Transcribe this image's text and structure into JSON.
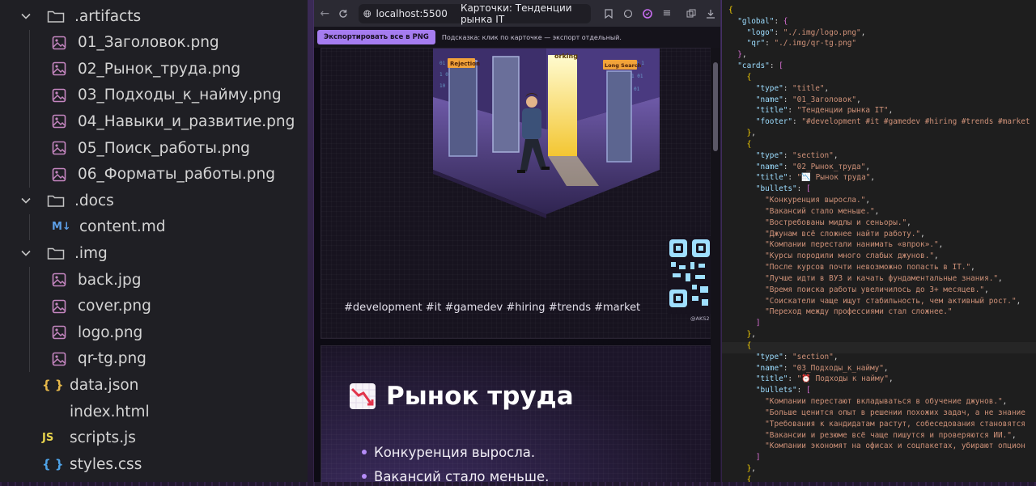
{
  "explorer": {
    "items": [
      {
        "label": ".artifacts",
        "kind": "folder",
        "depth": 0
      },
      {
        "label": "01_Заголовок.png",
        "kind": "image",
        "depth": 1
      },
      {
        "label": "02_Рынок_труда.png",
        "kind": "image",
        "depth": 1
      },
      {
        "label": "03_Подходы_к_найму.png",
        "kind": "image",
        "depth": 1
      },
      {
        "label": "04_Навыки_и_развитие.png",
        "kind": "image",
        "depth": 1
      },
      {
        "label": "05_Поиск_работы.png",
        "kind": "image",
        "depth": 1
      },
      {
        "label": "06_Форматы_работы.png",
        "kind": "image",
        "depth": 1
      },
      {
        "label": ".docs",
        "kind": "folder",
        "depth": 0
      },
      {
        "label": "content.md",
        "kind": "markdown",
        "depth": 1
      },
      {
        "label": ".img",
        "kind": "folder",
        "depth": 0
      },
      {
        "label": "back.jpg",
        "kind": "image",
        "depth": 1
      },
      {
        "label": "cover.png",
        "kind": "image",
        "depth": 1
      },
      {
        "label": "logo.png",
        "kind": "image",
        "depth": 1
      },
      {
        "label": "qr-tg.png",
        "kind": "image",
        "depth": 1
      },
      {
        "label": "data.json",
        "kind": "json",
        "depth": 0
      },
      {
        "label": "index.html",
        "kind": "html",
        "depth": 0
      },
      {
        "label": "scripts.js",
        "kind": "js",
        "depth": 0
      },
      {
        "label": "styles.css",
        "kind": "css",
        "depth": 0
      }
    ],
    "icons": {
      "md": "M↓",
      "json": "{ }",
      "html": "</>",
      "js": "JS",
      "css": "{ }"
    }
  },
  "browser": {
    "url_host": "localhost:5500",
    "tab_title": "Карточки: Тенденции рынка IT",
    "export_button": "Экспортировать все в PNG",
    "hint": "Подсказка: клик по карточке — экспорт отдельный.",
    "cover_labels": {
      "left": "Rejection",
      "center": "orking",
      "right": "Long Search"
    },
    "card1_footer": "#development #it #gamedev #hiring #trends #market",
    "qr_caption": "@AKS2",
    "card2_title": "Рынок труда",
    "card2_bullets": [
      "Конкуренция выросла.",
      "Вакансий стало меньше."
    ]
  },
  "editor": {
    "lines": [
      [
        {
          "t": "{",
          "c": "brace"
        }
      ],
      [
        {
          "t": "  \"global\"",
          "c": "key"
        },
        {
          "t": ": ",
          "c": "punc"
        },
        {
          "t": "{",
          "c": "bracket"
        }
      ],
      [
        {
          "t": "    \"logo\"",
          "c": "key"
        },
        {
          "t": ": ",
          "c": "punc"
        },
        {
          "t": "\"./.img/logo.png\"",
          "c": "str"
        },
        {
          "t": ",",
          "c": "punc"
        }
      ],
      [
        {
          "t": "    \"qr\"",
          "c": "key"
        },
        {
          "t": ": ",
          "c": "punc"
        },
        {
          "t": "\"./.img/qr-tg.png\"",
          "c": "str"
        }
      ],
      [
        {
          "t": "  }",
          "c": "bracket"
        },
        {
          "t": ",",
          "c": "punc"
        }
      ],
      [
        {
          "t": "  \"cards\"",
          "c": "key"
        },
        {
          "t": ": ",
          "c": "punc"
        },
        {
          "t": "[",
          "c": "bracket"
        }
      ],
      [
        {
          "t": "    {",
          "c": "brace"
        }
      ],
      [
        {
          "t": "      \"type\"",
          "c": "key"
        },
        {
          "t": ": ",
          "c": "punc"
        },
        {
          "t": "\"title\"",
          "c": "str"
        },
        {
          "t": ",",
          "c": "punc"
        }
      ],
      [
        {
          "t": "      \"name\"",
          "c": "key"
        },
        {
          "t": ": ",
          "c": "punc"
        },
        {
          "t": "\"01_Заголовок\"",
          "c": "str"
        },
        {
          "t": ",",
          "c": "punc"
        }
      ],
      [
        {
          "t": "      \"title\"",
          "c": "key"
        },
        {
          "t": ": ",
          "c": "punc"
        },
        {
          "t": "\"Тенденции рынка IT\"",
          "c": "str"
        },
        {
          "t": ",",
          "c": "punc"
        }
      ],
      [
        {
          "t": "      \"footer\"",
          "c": "key"
        },
        {
          "t": ": ",
          "c": "punc"
        },
        {
          "t": "\"#development #it #gamedev #hiring #trends #market",
          "c": "str"
        }
      ],
      [
        {
          "t": "    }",
          "c": "brace"
        },
        {
          "t": ",",
          "c": "punc"
        }
      ],
      [
        {
          "t": "    {",
          "c": "brace"
        }
      ],
      [
        {
          "t": "      \"type\"",
          "c": "key"
        },
        {
          "t": ": ",
          "c": "punc"
        },
        {
          "t": "\"section\"",
          "c": "str"
        },
        {
          "t": ",",
          "c": "punc"
        }
      ],
      [
        {
          "t": "      \"name\"",
          "c": "key"
        },
        {
          "t": ": ",
          "c": "punc"
        },
        {
          "t": "\"02_Рынок_труда\"",
          "c": "str"
        },
        {
          "t": ",",
          "c": "punc"
        }
      ],
      [
        {
          "t": "      \"title\"",
          "c": "key"
        },
        {
          "t": ": ",
          "c": "punc"
        },
        {
          "t": "\"📉 Рынок труда\"",
          "c": "str"
        },
        {
          "t": ",",
          "c": "punc"
        }
      ],
      [
        {
          "t": "      \"bullets\"",
          "c": "key"
        },
        {
          "t": ": ",
          "c": "punc"
        },
        {
          "t": "[",
          "c": "bracket"
        }
      ],
      [
        {
          "t": "        \"Конкуренция выросла.\"",
          "c": "str"
        },
        {
          "t": ",",
          "c": "punc"
        }
      ],
      [
        {
          "t": "        \"Вакансий стало меньше.\"",
          "c": "str"
        },
        {
          "t": ",",
          "c": "punc"
        }
      ],
      [
        {
          "t": "        \"Востребованы мидлы и сеньоры.\"",
          "c": "str"
        },
        {
          "t": ",",
          "c": "punc"
        }
      ],
      [
        {
          "t": "        \"Джунам всё сложнее найти работу.\"",
          "c": "str"
        },
        {
          "t": ",",
          "c": "punc"
        }
      ],
      [
        {
          "t": "        \"Компании перестали нанимать «впрок».\"",
          "c": "str"
        },
        {
          "t": ",",
          "c": "punc"
        }
      ],
      [
        {
          "t": "        \"Курсы породили много слабых джунов.\"",
          "c": "str"
        },
        {
          "t": ",",
          "c": "punc"
        }
      ],
      [
        {
          "t": "        \"После курсов почти невозможно попасть в IT.\"",
          "c": "str"
        },
        {
          "t": ",",
          "c": "punc"
        }
      ],
      [
        {
          "t": "        \"Лучше идти в ВУЗ и качать фундаментальные знания.\"",
          "c": "str"
        },
        {
          "t": ",",
          "c": "punc"
        }
      ],
      [
        {
          "t": "        \"Время поиска работы увеличилось до 3+ месяцев.\"",
          "c": "str"
        },
        {
          "t": ",",
          "c": "punc"
        }
      ],
      [
        {
          "t": "        \"Соискатели чаще ищут стабильность, чем активный рост.\"",
          "c": "str"
        },
        {
          "t": ",",
          "c": "punc"
        }
      ],
      [
        {
          "t": "        \"Переход между профессиями стал сложнее.\"",
          "c": "str"
        }
      ],
      [
        {
          "t": "      ]",
          "c": "bracket"
        }
      ],
      [
        {
          "t": "    }",
          "c": "brace"
        },
        {
          "t": ",",
          "c": "punc"
        }
      ],
      [
        {
          "t": "    {",
          "c": "brace"
        }
      ],
      [
        {
          "t": "      \"type\"",
          "c": "key"
        },
        {
          "t": ": ",
          "c": "punc"
        },
        {
          "t": "\"section\"",
          "c": "str"
        },
        {
          "t": ",",
          "c": "punc"
        }
      ],
      [
        {
          "t": "      \"name\"",
          "c": "key"
        },
        {
          "t": ": ",
          "c": "punc"
        },
        {
          "t": "\"03_Подходы_к_найму\"",
          "c": "str"
        },
        {
          "t": ",",
          "c": "punc"
        }
      ],
      [
        {
          "t": "      \"title\"",
          "c": "key"
        },
        {
          "t": ": ",
          "c": "punc"
        },
        {
          "t": "\"⏰ Подходы к найму\"",
          "c": "str"
        },
        {
          "t": ",",
          "c": "punc"
        }
      ],
      [
        {
          "t": "      \"bullets\"",
          "c": "key"
        },
        {
          "t": ": ",
          "c": "punc"
        },
        {
          "t": "[",
          "c": "bracket"
        }
      ],
      [
        {
          "t": "        \"Компании перестают вкладываться в обучение джунов.\"",
          "c": "str"
        },
        {
          "t": ",",
          "c": "punc"
        }
      ],
      [
        {
          "t": "        \"Больше ценится опыт в решении похожих задач, а не знание",
          "c": "str"
        }
      ],
      [
        {
          "t": "        \"Требования к кандидатам растут, собеседования становятся",
          "c": "str"
        }
      ],
      [
        {
          "t": "        \"Вакансии и резюме всё чаще пишутся и проверяются ИИ.\"",
          "c": "str"
        },
        {
          "t": ",",
          "c": "punc"
        }
      ],
      [
        {
          "t": "        \"Компании экономят на офисах и соцпакетах, убирают опцион",
          "c": "str"
        }
      ],
      [
        {
          "t": "      ]",
          "c": "bracket"
        }
      ],
      [
        {
          "t": "    }",
          "c": "brace"
        },
        {
          "t": ",",
          "c": "punc"
        }
      ],
      [
        {
          "t": "    {",
          "c": "brace"
        }
      ]
    ]
  },
  "colors": {
    "accent": "#a57cf0",
    "bullet": "#b58cf7"
  }
}
